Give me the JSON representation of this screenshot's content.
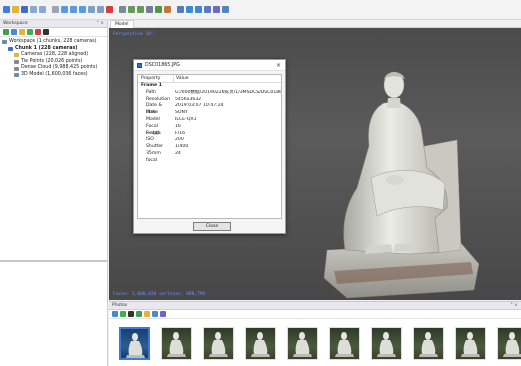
{
  "toolbar": {
    "icons": [
      {
        "name": "new-project-icon",
        "color": "#3f7fd8"
      },
      {
        "name": "open-icon",
        "color": "#e2b23b"
      },
      {
        "name": "save-icon",
        "color": "#3f6cc6"
      },
      {
        "name": "undo-icon",
        "color": "#8aa8d0"
      },
      {
        "name": "redo-icon",
        "color": "#8aa8d0"
      },
      {
        "name": "navigation-icon",
        "color": "#9aa6b8"
      },
      {
        "name": "rectangle-selection-icon",
        "color": "#5a9be0"
      },
      {
        "name": "circle-selection-icon",
        "color": "#5a9be0"
      },
      {
        "name": "free-form-selection-icon",
        "color": "#5a9be0"
      },
      {
        "name": "resize-region-icon",
        "color": "#7fa0c0"
      },
      {
        "name": "move-region-icon",
        "color": "#7fa0c0"
      },
      {
        "name": "delete-selection-icon",
        "color": "#d04040"
      },
      {
        "name": "crop-selection-icon",
        "color": "#7a8a9a"
      },
      {
        "name": "point-cloud-icon",
        "color": "#6a9a5a"
      },
      {
        "name": "dense-cloud-icon",
        "color": "#6a9a5a"
      },
      {
        "name": "mesh-icon",
        "color": "#7a7a9a"
      },
      {
        "name": "shaded-icon",
        "color": "#4a9a4a"
      },
      {
        "name": "textured-icon",
        "color": "#c07a3a"
      },
      {
        "name": "tiled-model-icon",
        "color": "#5a7ac0"
      },
      {
        "name": "show-cameras-icon",
        "color": "#3a8ad0"
      },
      {
        "name": "show-markers-icon",
        "color": "#3a8ad0"
      },
      {
        "name": "region-icon",
        "color": "#5a7ac0"
      },
      {
        "name": "show-trackball-icon",
        "color": "#6a6ac0"
      },
      {
        "name": "reset-view-icon",
        "color": "#4a8ac0"
      }
    ]
  },
  "workspace": {
    "title": "Workspace",
    "title_controls": "° ×",
    "tools": [
      {
        "name": "add-chunk-icon",
        "color": "#3f9f4f"
      },
      {
        "name": "add-photos-icon",
        "color": "#4a8ad0"
      },
      {
        "name": "add-folder-icon",
        "color": "#e2b23b"
      },
      {
        "name": "enable-icon",
        "color": "#3faf4f"
      },
      {
        "name": "disable-icon",
        "color": "#d04040"
      },
      {
        "name": "remove-items-icon",
        "color": "#333333"
      }
    ],
    "tree": [
      {
        "label": "Workspace (1 chunks, 228 cameras)",
        "indent": 0,
        "icon": "workspace-icon",
        "color": "#6a8ab0",
        "bold": false
      },
      {
        "label": "Chunk 1 (228 cameras)",
        "indent": 1,
        "icon": "chunk-icon",
        "color": "#3f6cc6",
        "bold": true
      },
      {
        "label": "Cameras (228, 228 aligned)",
        "indent": 2,
        "icon": "cameras-folder-icon",
        "color": "#e2b23b",
        "bold": false
      },
      {
        "label": "Tie Points (20,026 points)",
        "indent": 2,
        "icon": "tie-points-icon",
        "color": "#8a8a8a",
        "bold": false
      },
      {
        "label": "Dense Cloud (9,988,425 points)",
        "indent": 2,
        "icon": "dense-cloud-icon",
        "color": "#8a8a8a",
        "bold": false
      },
      {
        "label": "3D Model (1,600,036 faces)",
        "indent": 2,
        "icon": "model-icon",
        "color": "#6a8ab0",
        "bold": false
      }
    ]
  },
  "model_view": {
    "tab_label": "Model",
    "perspective_label": "Perspective 30°",
    "status_text": "Faces: 1,600,036 vertices: 800,799"
  },
  "dialog": {
    "title": "DSC01865.JPG",
    "close_glyph": "×",
    "headers": {
      "property": "Property",
      "value": "Value"
    },
    "section": "Frame 1",
    "rows": [
      {
        "property": "Path",
        "value": "G:/000数据/20190226陈贞/1/3MSDCS/DSC01865.JPG"
      },
      {
        "property": "Resolution",
        "value": "5456x3632"
      },
      {
        "property": "Date & time",
        "value": "2019:03:07 10:47:24"
      },
      {
        "property": "Make",
        "value": "SONY"
      },
      {
        "property": "Model",
        "value": "ILCE-QX1"
      },
      {
        "property": "Focal length",
        "value": "16"
      },
      {
        "property": "F-stop",
        "value": "F/16"
      },
      {
        "property": "ISO",
        "value": "200"
      },
      {
        "property": "Shutter",
        "value": "1/400"
      },
      {
        "property": "35mm focal",
        "value": "24"
      }
    ],
    "close_button": "Close"
  },
  "photos": {
    "title": "Photos",
    "title_controls": "° ×",
    "tools": [
      {
        "name": "add-photos-icon",
        "color": "#4a8ad0"
      },
      {
        "name": "enable-icon",
        "color": "#3faf4f"
      },
      {
        "name": "remove-icon",
        "color": "#333333"
      },
      {
        "name": "rotate-icon",
        "color": "#3f9f4f"
      },
      {
        "name": "reset-filter-icon",
        "color": "#e2b23b"
      },
      {
        "name": "view-details-icon",
        "color": "#4a8ad0"
      },
      {
        "name": "thumbnail-size-icon",
        "color": "#6a6ac0"
      }
    ],
    "thumbnail_count": 10,
    "selected_index": 0
  }
}
